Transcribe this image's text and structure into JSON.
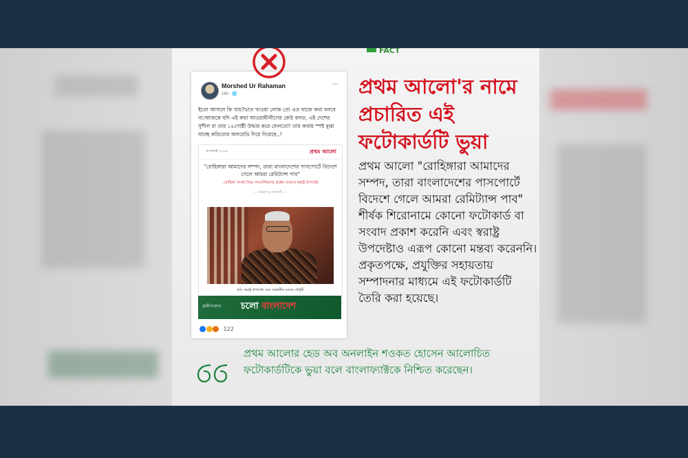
{
  "logo": {
    "text": "FACT"
  },
  "facebook_post": {
    "author": "Morshed Ur Rahaman",
    "time": "16h · 🌐",
    "menu": "···",
    "text": "ইতো আসলে কি খায়?ভাত খাওয়া লোক তো এত বাজে কথা বলবে না;আজকে যদি এই কথা আওয়ামীলীগের কেউ বলত, এই দেশের সুশীল রা তার ১৪গোষ্ঠী উদ্ধার করে ফেলতো! তার কথায় স্পষ্ট বুঝা যাচ্ছে করিডোর অলরেডি দিয়ে দিয়েছে..!",
    "photocard": {
      "date": "আসলেই ২০২৫",
      "logo": "প্রথম আলো",
      "quote": "\"রোহিঙ্গারা আমাদের সম্পদ, তারা বাংলাদেশের পাসপোর্টে বিদেশে গেলে আমরা রেমিট্যান্স পাব\"",
      "subtitle": "-রোহিঙ্গা সংকট নিয়ে সাংবাদিকদের প্রশ্নের জবাবে স্বরাষ্ট্র উপদেষ্টা",
      "ad_label": "— বিজ্ঞাপন কলামটি —",
      "caption": "ছবি: স্বরাষ্ট্র উপদেষ্টা মোঃ জাহাঙ্গীর আলম চৌধুরী"
    },
    "banner": {
      "brand": "গ্রামীণফোন",
      "text_left": "চলো ",
      "text_right": "বাংলাদেশ"
    },
    "reactions_count": "122"
  },
  "headline": "প্রথম আলো'র নামে প্রচারিত এই ফটোকার্ডটি ভুয়া",
  "body": "প্রথম আলো \"রোহিঙ্গারা আমাদের সম্পদ, তারা বাংলাদেশের পাসপোর্টে বিদেশে গেলে আমরা রেমিট্যান্স পাব\" শীর্ষক শিরোনামে কোনো ফটোকার্ড বা সংবাদ প্রকাশ করেনি এবং স্বরাষ্ট্র উপদেষ্টাও এরূপ কোনো মন্তব্য করেননি। প্রকৃতপক্ষে, প্রযুক্তির সহায়তায় সম্পাদনার মাধ্যমে এই ফটোকার্ডটি তৈরি করা হয়েছে।",
  "quote": "প্রথম আলোর হেড অব অনলাইন শওকত হোসেন আলোচিত ফটোকার্ডটিকে ভুয়া বলে বাংলাফ্যাক্টকে নিশ্চিত করেছেন।",
  "colors": {
    "headline": "#d4111d",
    "quote": "#17823a",
    "band": "#1b2f44"
  }
}
